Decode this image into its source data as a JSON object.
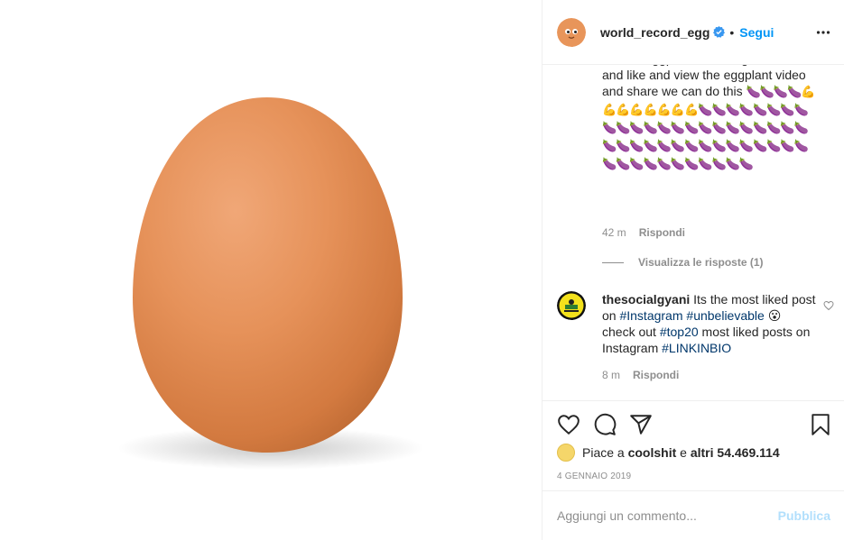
{
  "header": {
    "username": "world_record_egg",
    "separator": "•",
    "follow_label": "Segui"
  },
  "comments": [
    {
      "text_start": "viewed eggplant on instagram , come and like and view the eggplant video and share we can do this ",
      "emoji": "🍆🍆🍆🍆💪💪💪💪💪💪💪💪🍆🍆🍆🍆🍆🍆🍆🍆🍆🍆🍆🍆🍆🍆🍆🍆🍆🍆🍆🍆🍆🍆🍆🍆🍆🍆🍆🍆🍆🍆🍆🍆🍆🍆🍆🍆🍆🍆🍆🍆🍆🍆🍆🍆🍆🍆🍆🍆🍆",
      "time": "42 m",
      "reply_label": "Rispondi",
      "view_replies": "Visualizza le risposte (1)"
    },
    {
      "username": "thesocialgyani",
      "text_a": "Its the most liked post on",
      "tag1": "#Instagram",
      "tag2": "#unbelievable",
      "emoji": "😮",
      "text_b": "check out",
      "tag3": "#top20",
      "text_c": "most liked posts on Instagram",
      "tag4": "#LINKINBIO",
      "time": "8 m",
      "reply_label": "Rispondi"
    }
  ],
  "likes": {
    "prefix": "Piace a",
    "user": "coolshit",
    "conjunction": "e",
    "others": "altri 54.469.114"
  },
  "date": "4 GENNAIO 2019",
  "add_comment": {
    "placeholder": "Aggiungi un commento...",
    "publish_label": "Pubblica"
  },
  "colors": {
    "link_blue": "#0095f6",
    "hashtag": "#00376b",
    "muted": "#8e8e8e",
    "publish_disabled": "#b2dffc",
    "egg": "#e8955a"
  }
}
